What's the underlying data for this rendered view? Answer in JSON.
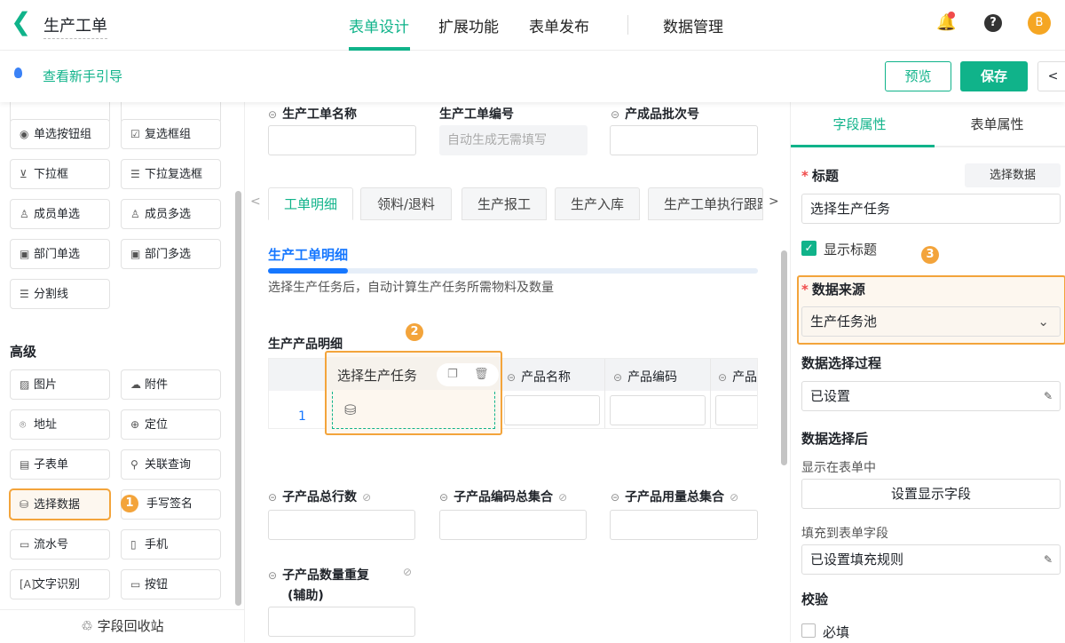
{
  "header": {
    "back": "<",
    "title": "生产工单",
    "nav": [
      "表单设计",
      "扩展功能",
      "表单发布",
      "数据管理"
    ],
    "avatar": "B",
    "help": "?"
  },
  "toolbar": {
    "guide": "查看新手引导",
    "preview": "预览",
    "save": "保存",
    "share_icon": "share-icon"
  },
  "left": {
    "basic": [
      [
        "单选按钮组",
        "复选框组"
      ],
      [
        "下拉框",
        "下拉复选框"
      ],
      [
        "成员单选",
        "成员多选"
      ],
      [
        "部门单选",
        "部门多选"
      ],
      [
        "分割线"
      ]
    ],
    "advanced_title": "高级",
    "advanced": [
      [
        "图片",
        "附件"
      ],
      [
        "地址",
        "定位"
      ],
      [
        "子表单",
        "关联查询"
      ],
      [
        "选择数据",
        "手写签名"
      ],
      [
        "流水号",
        "手机"
      ],
      [
        "文字识别",
        "按钮"
      ]
    ],
    "recycle": "字段回收站"
  },
  "badges": [
    "1",
    "2",
    "3"
  ],
  "center": {
    "top_fields": [
      {
        "label": "生产工单名称"
      },
      {
        "label": "生产工单编号",
        "value": "自动生成无需填写"
      },
      {
        "label": "产成品批次号"
      }
    ],
    "tabs": [
      "工单明细",
      "领料/退料",
      "生产报工",
      "生产入库",
      "生产工单执行跟踪"
    ],
    "section_title": "生产工单明细",
    "section_desc": "选择生产任务后，自动计算生产任务所需物料及数量",
    "table_title": "生产产品明细",
    "table_columns": [
      "选择生产任务",
      "产品名称",
      "产品编码",
      "产品"
    ],
    "row_number": "1",
    "fields": [
      "子产品总行数",
      "子产品编码总集合",
      "子产品用量总集合",
      "子产品数量重复",
      "(辅助)"
    ]
  },
  "right": {
    "tabs": [
      "字段属性",
      "表单属性"
    ],
    "title_label": "标题",
    "select_data_btn": "选择数据",
    "title_value": "选择生产任务",
    "show_title": "显示标题",
    "source_label": "数据来源",
    "source_value": "生产任务池",
    "process_label": "数据选择过程",
    "process_value": "已设置",
    "after_label": "数据选择后",
    "display_label": "显示在表单中",
    "display_btn": "设置显示字段",
    "fill_label": "填充到表单字段",
    "fill_value": "已设置填充规则",
    "validate_label": "校验",
    "required": "必填"
  },
  "colors": {
    "accent": "#10b38a",
    "highlight": "#f3a43b"
  }
}
